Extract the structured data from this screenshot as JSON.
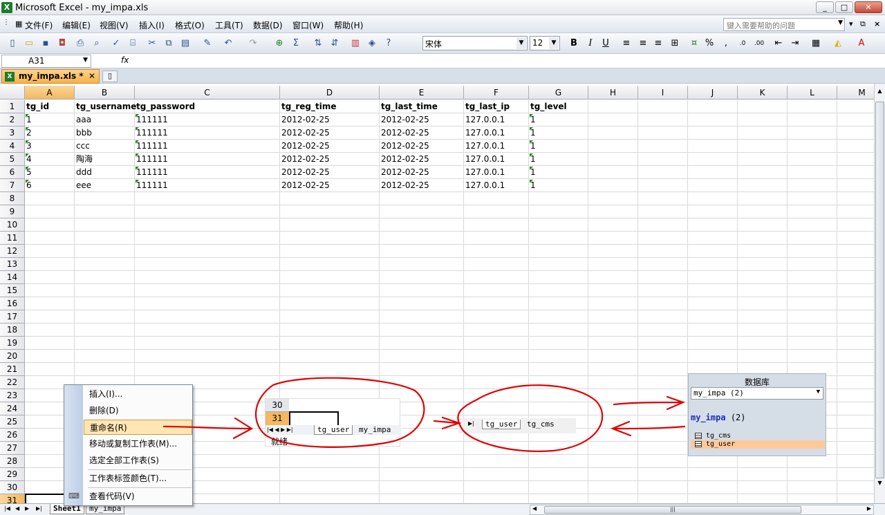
{
  "window": {
    "title": "Microsoft Excel - my_impa.xls",
    "min": "_",
    "max": "□",
    "close": "✕"
  },
  "menu": {
    "items": [
      "文件(F)",
      "编辑(E)",
      "视图(V)",
      "插入(I)",
      "格式(O)",
      "工具(T)",
      "数据(D)",
      "窗口(W)",
      "帮助(H)"
    ],
    "help_placeholder": "键入需要帮助的问题",
    "ctl_dd": "▾",
    "ctl_restore": "⧉",
    "ctl_close": "×"
  },
  "toolbar": {
    "font": "宋体",
    "size": "12",
    "bold": "B",
    "italic": "I",
    "underline": "U",
    "percent": "%",
    "comma": ","
  },
  "formula": {
    "cell_ref": "A31",
    "fx": "fx",
    "value": ""
  },
  "doc_tab": {
    "name": "my_impa.xls *",
    "close": "✕"
  },
  "columns": [
    "A",
    "B",
    "C",
    "D",
    "E",
    "F",
    "G",
    "H",
    "I",
    "J",
    "K",
    "L",
    "M"
  ],
  "rows": [
    "1",
    "2",
    "3",
    "4",
    "5",
    "6",
    "7",
    "8",
    "9",
    "10",
    "11",
    "12",
    "13",
    "14",
    "15",
    "16",
    "17",
    "18",
    "19",
    "20",
    "21",
    "22",
    "23",
    "24",
    "25",
    "26",
    "27",
    "28",
    "29",
    "30",
    "31"
  ],
  "table": {
    "headers": [
      "tg_id",
      "tg_username",
      "tg_password",
      "tg_reg_time",
      "tg_last_time",
      "tg_last_ip",
      "tg_level"
    ],
    "rows": [
      [
        "1",
        "aaa",
        "111111",
        "2012-02-25",
        "2012-02-25",
        "127.0.0.1",
        "1"
      ],
      [
        "2",
        "bbb",
        "111111",
        "2012-02-25",
        "2012-02-25",
        "127.0.0.1",
        "1"
      ],
      [
        "3",
        "ccc",
        "111111",
        "2012-02-25",
        "2012-02-25",
        "127.0.0.1",
        "1"
      ],
      [
        "4",
        "陶海",
        "111111",
        "2012-02-25",
        "2012-02-25",
        "127.0.0.1",
        "1"
      ],
      [
        "5",
        "ddd",
        "111111",
        "2012-02-25",
        "2012-02-25",
        "127.0.0.1",
        "1"
      ],
      [
        "6",
        "eee",
        "111111",
        "2012-02-25",
        "2012-02-25",
        "127.0.0.1",
        "1"
      ]
    ]
  },
  "context_menu": [
    "插入(I)...",
    "删除(D)",
    "重命名(R)",
    "移动或复制工作表(M)...",
    "选定全部工作表(S)",
    "工作表标签颜色(T)...",
    "查看代码(V)"
  ],
  "sheet_tabs": [
    "Sheet1",
    "my_impa"
  ],
  "inset1": {
    "row30": "30",
    "row31": "31",
    "tabs": [
      "tg_user",
      "my_impa"
    ],
    "status": "就绪"
  },
  "inset2": {
    "tabs": [
      "tg_user",
      "tg_cms"
    ]
  },
  "db_panel": {
    "title": "数据库",
    "selected": "my_impa (2)",
    "db_name": "my_impa",
    "db_count": "(2)",
    "tables": [
      "tg_cms",
      "tg_user"
    ]
  },
  "colors": {
    "annotation": "#e00000",
    "selected_header": "#f4b860",
    "highlight": "#fdc998"
  }
}
